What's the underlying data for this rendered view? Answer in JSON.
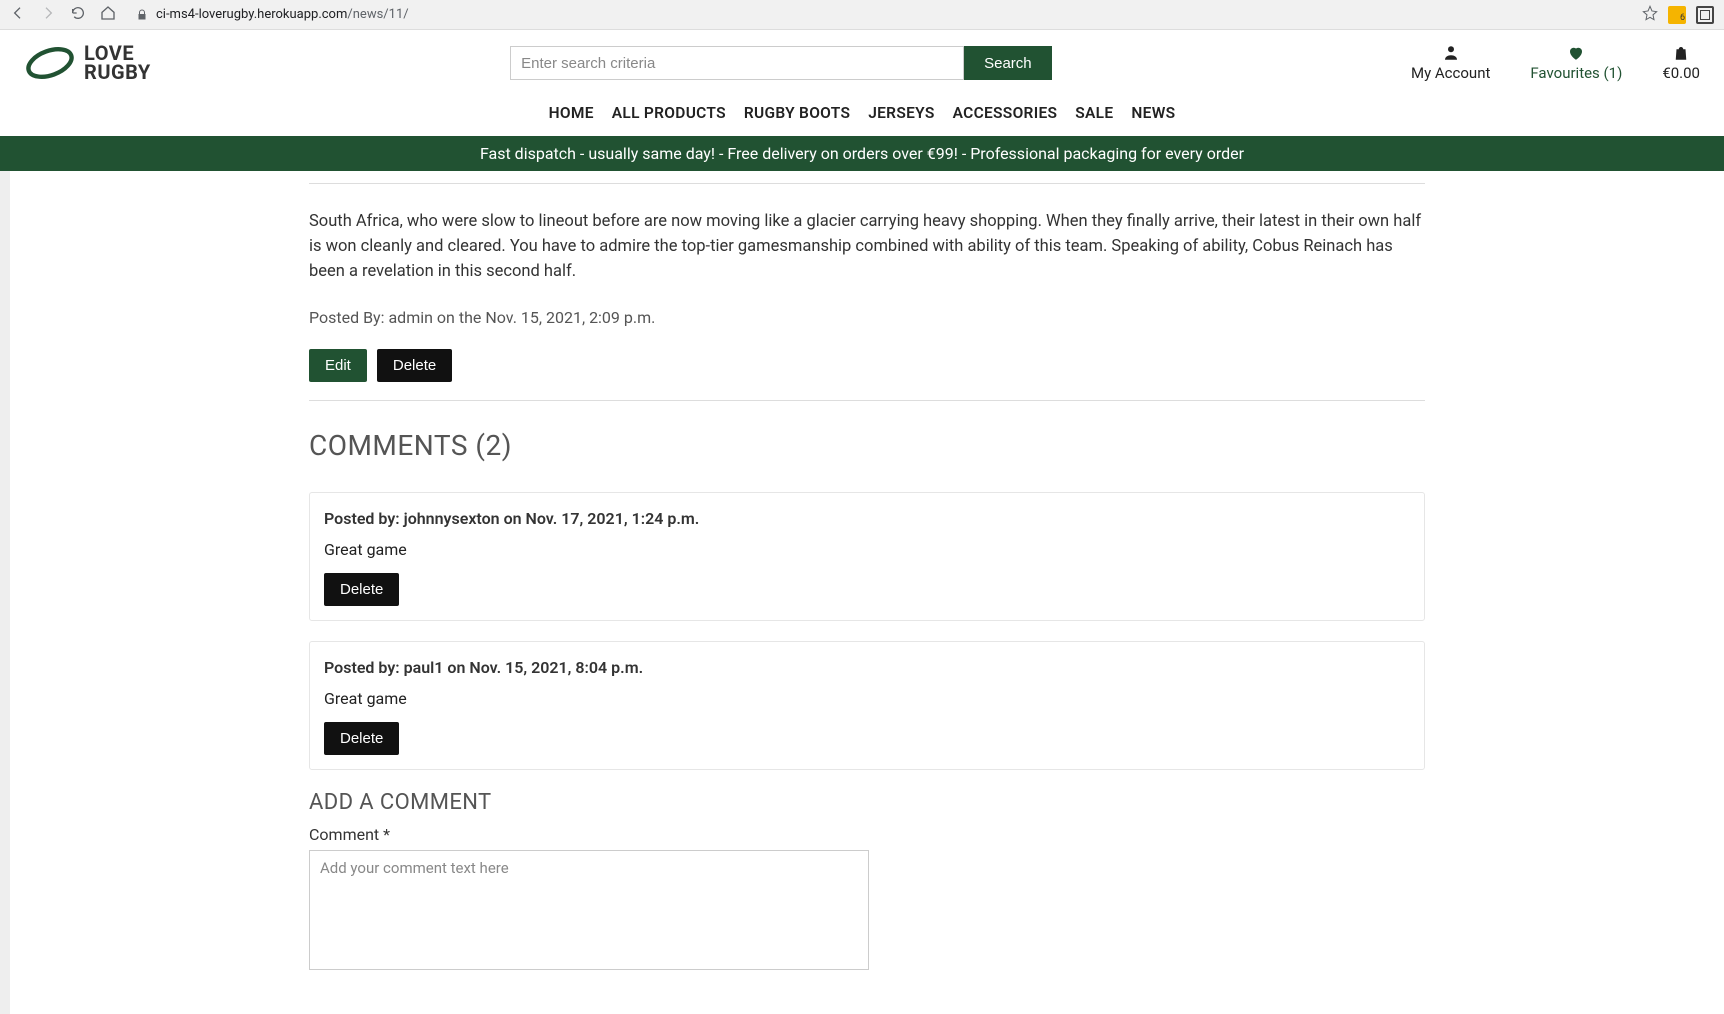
{
  "browser": {
    "url_domain": "ci-ms4-loverugby.herokuapp.com",
    "url_path": "/news/11/"
  },
  "logo": {
    "line1": "LOVE",
    "line2": "RUGBY"
  },
  "search": {
    "placeholder": "Enter search criteria",
    "button": "Search"
  },
  "header_icons": {
    "account": "My Account",
    "favourites": "Favourites (1)",
    "cart": "€0.00"
  },
  "nav": [
    "HOME",
    "ALL PRODUCTS",
    "RUGBY BOOTS",
    "JERSEYS",
    "ACCESSORIES",
    "SALE",
    "NEWS"
  ],
  "banner": "Fast dispatch - usually same day! - Free delivery on orders over €99! - Professional packaging for every order",
  "article": {
    "body": "South Africa, who were slow to lineout before are now moving like a glacier carrying heavy shopping. When they finally arrive, their latest in their own half is won cleanly and cleared. You have to admire the top-tier gamesmanship combined with ability of this team. Speaking of ability, Cobus Reinach has been a revelation in this second half.",
    "posted_by": "Posted By: admin on the Nov. 15, 2021, 2:09 p.m.",
    "edit": "Edit",
    "delete": "Delete"
  },
  "comments": {
    "title": "COMMENTS (2)",
    "items": [
      {
        "meta": "Posted by: johnnysexton on Nov. 17, 2021, 1:24 p.m.",
        "text": "Great game",
        "delete": "Delete"
      },
      {
        "meta": "Posted by: paul1 on Nov. 15, 2021, 8:04 p.m.",
        "text": "Great game",
        "delete": "Delete"
      }
    ]
  },
  "add_comment": {
    "title": "ADD A COMMENT",
    "label": "Comment *",
    "placeholder": "Add your comment text here"
  }
}
